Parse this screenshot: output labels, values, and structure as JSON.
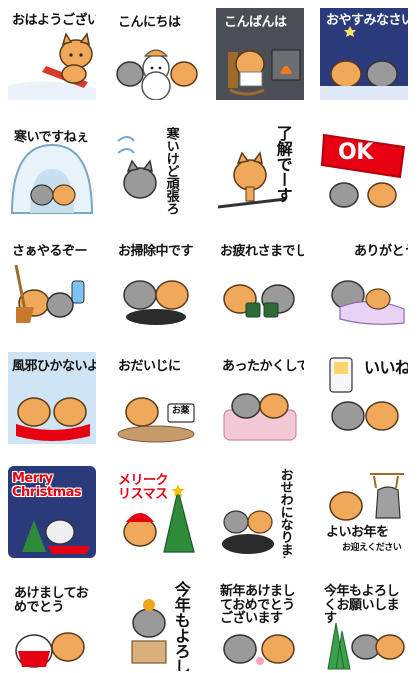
{
  "stickers": [
    {
      "text": "おはようございます"
    },
    {
      "text": "こんにちは"
    },
    {
      "text": "こんばんは"
    },
    {
      "text": "おやすみなさい"
    },
    {
      "text": "寒いですねぇ"
    },
    {
      "text": "寒いけど頑張ろう"
    },
    {
      "text": "了解でーす"
    },
    {
      "text": "OK"
    },
    {
      "text": "さぁやるぞー"
    },
    {
      "text": "お掃除中です"
    },
    {
      "text": "お疲れさまでした"
    },
    {
      "text": "ありがとう"
    },
    {
      "text": "風邪ひかないように"
    },
    {
      "text": "おだいじに"
    },
    {
      "text": "あったかくしてね"
    },
    {
      "text": "いいねぇ"
    },
    {
      "text": "Merry Christmas"
    },
    {
      "text": "メリークリスマス"
    },
    {
      "text": "おせわになりました"
    },
    {
      "text": "よいお年を"
    },
    {
      "text": "あけましておめでとう"
    },
    {
      "text": "今年もよろしく"
    },
    {
      "text": "新年あけましておめでとうございます"
    },
    {
      "text": "今年もよろしくお願いします"
    }
  ],
  "extra": {
    "sub_okusuri": "お薬",
    "sub_yoi_omukae": "お迎えください"
  },
  "colors": {
    "cat_orange": "#f0a85a",
    "cat_gray": "#9a9a9a",
    "night_bg": "#2a3a7a",
    "snow_blue": "#cfe5f5",
    "red": "#e60012"
  }
}
